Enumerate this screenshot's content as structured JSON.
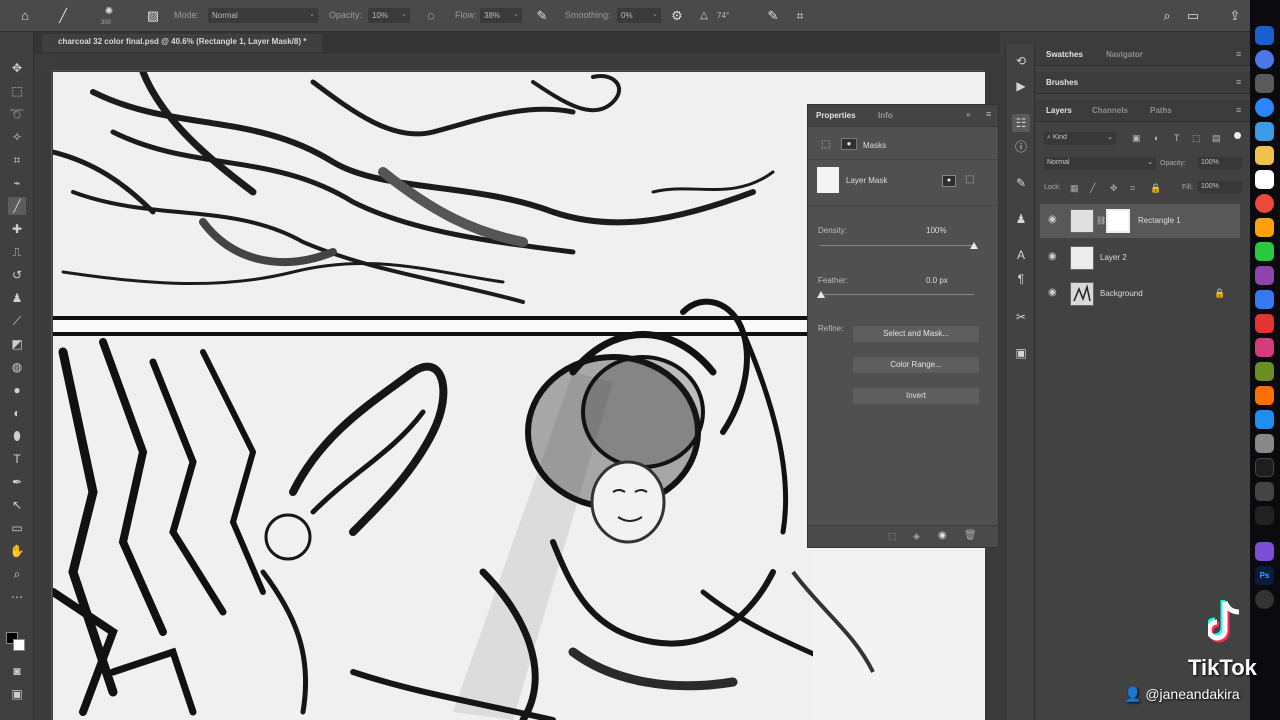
{
  "options_bar": {
    "brush_size": "300",
    "mode_label": "Mode:",
    "mode_value": "Normal",
    "opacity_label": "Opacity:",
    "opacity_value": "10%",
    "flow_label": "Flow:",
    "flow_value": "38%",
    "smoothing_label": "Smoothing:",
    "smoothing_value": "0%",
    "angle_value": "74°"
  },
  "document": {
    "tab_title": "charcoal 32 color final.psd @ 40.6% (Rectangle 1, Layer Mask/8) *"
  },
  "properties": {
    "tabs": [
      "Properties",
      "Info"
    ],
    "section": "Masks",
    "mask_label": "Layer Mask",
    "density_label": "Density:",
    "density_value": "100%",
    "density_level": 1.0,
    "feather_label": "Feather:",
    "feather_value": "0.0 px",
    "feather_level": 0.0,
    "refine_label": "Refine:",
    "buttons": [
      "Select and Mask...",
      "Color Range...",
      "Invert"
    ]
  },
  "panels": {
    "top_tabs": [
      "Swatches",
      "Navigator"
    ],
    "brushes_tab": "Brushes",
    "layers_tabs": [
      "Layers",
      "Channels",
      "Paths"
    ],
    "filter_kind": "Kind",
    "blend_mode": "Normal",
    "opacity_label": "Opacity:",
    "opacity_value": "100%",
    "lock_label": "Lock:",
    "fill_label": "Fill:",
    "fill_value": "100%"
  },
  "layers": [
    {
      "name": "Rectangle 1",
      "selected": true
    },
    {
      "name": "Layer 2",
      "selected": false
    },
    {
      "name": "Background",
      "selected": false,
      "locked": true
    }
  ],
  "overlay": {
    "logo": "TikTok",
    "username": "@janeandakira"
  },
  "colors": {
    "ui_dark": "#3c3c3c",
    "panel": "#505050",
    "selected_layer": "#585858",
    "tiktok_cyan": "#25f4ee",
    "tiktok_red": "#fe2c55"
  }
}
